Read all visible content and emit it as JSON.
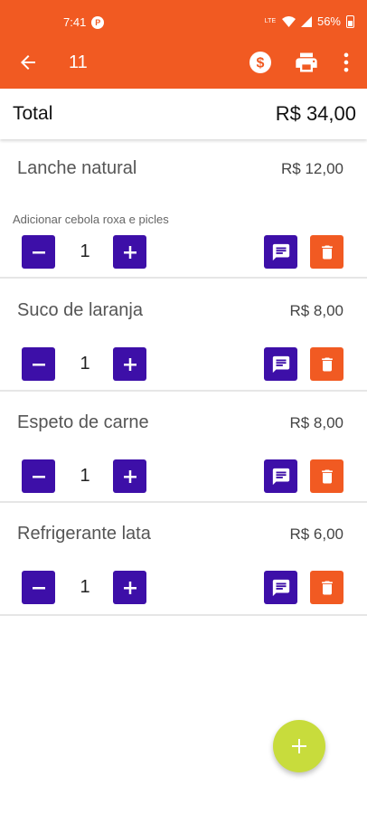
{
  "status_bar": {
    "time": "7:41",
    "lte": "LTE",
    "battery": "56%"
  },
  "app_bar": {
    "title": "11"
  },
  "summary": {
    "label": "Total",
    "value": "R$ 34,00"
  },
  "items": [
    {
      "name": "Lanche natural",
      "price": "R$ 12,00",
      "note": "Adicionar cebola roxa e picles",
      "qty": "1"
    },
    {
      "name": "Suco de laranja",
      "price": "R$ 8,00",
      "qty": "1"
    },
    {
      "name": "Espeto de carne",
      "price": "R$ 8,00",
      "qty": "1"
    },
    {
      "name": "Refrigerante lata",
      "price": "R$ 6,00",
      "qty": "1"
    }
  ],
  "colors": {
    "primary": "#f15a22",
    "accent": "#3d0fa8",
    "fab": "#c8dc3c"
  },
  "icons": [
    "arrow-back-icon",
    "money-icon",
    "print-icon",
    "more-vert-icon",
    "minus-icon",
    "plus-icon",
    "comment-icon",
    "trash-icon",
    "add-icon"
  ]
}
